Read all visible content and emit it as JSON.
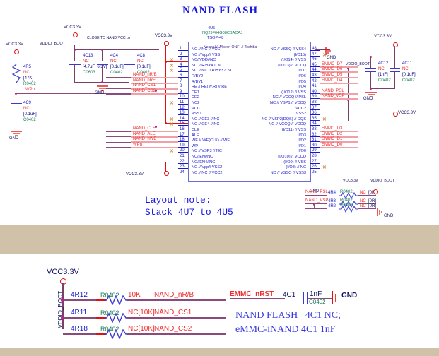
{
  "sheet": {
    "title": "NAND FLASH",
    "layout_note_line1": "Layout note:",
    "layout_note_line2": "Stack 4U7 to 4U5",
    "note_close": "CLOSE TO NAND VCC pin",
    "bottom_note_line1": "NAND FLASH   4C1 NC;",
    "bottom_note_line2": "eMMC-iNAND 4C1 1nF"
  },
  "chip": {
    "refdes": "4U5",
    "part": "NQ29F64G08CBACAJ",
    "package": "TSOP-48",
    "header": "Normal // Micron ONFI // Toshiba",
    "left_pins": [
      {
        "num": "1",
        "name": "NC // NC // VCC"
      },
      {
        "num": "2",
        "name": "NC // Vpp// VSS"
      },
      {
        "num": "3",
        "name": "NC//VDD//NC"
      },
      {
        "num": "4",
        "name": "NC // R/BY4 // NC"
      },
      {
        "num": "5",
        "name": "NC // NC // R/BY3 // NC"
      },
      {
        "num": "6",
        "name": "R/BY2"
      },
      {
        "num": "7",
        "name": "R/BY1"
      },
      {
        "num": "8",
        "name": "RE // RE(W,R) // RE"
      },
      {
        "num": "9",
        "name": "CE1"
      },
      {
        "num": "10",
        "name": "CE2"
      },
      {
        "num": "11",
        "name": "NC2"
      },
      {
        "num": "12",
        "name": "VCC1"
      },
      {
        "num": "13",
        "name": "VSS1"
      },
      {
        "num": "14",
        "name": "NC // CE3 // NC"
      },
      {
        "num": "15",
        "name": "NC // CE4 // NC"
      },
      {
        "num": "16",
        "name": "CLE"
      },
      {
        "num": "17",
        "name": "ALE"
      },
      {
        "num": "18",
        "name": "WE // WE(CLK) // WE"
      },
      {
        "num": "19",
        "name": "WP"
      },
      {
        "num": "20",
        "name": "NC // VSP3 // NC"
      },
      {
        "num": "21",
        "name": "NC//EN//NC"
      },
      {
        "num": "22",
        "name": "NC//EN4//NC"
      },
      {
        "num": "23",
        "name": "NC // Vpp// VSS2"
      },
      {
        "num": "24",
        "name": "NC // NC // VCC2"
      }
    ],
    "right_pins": [
      {
        "num": "48",
        "name": "NC // VSSQ // VSS4"
      },
      {
        "num": "47",
        "name": "(I/O15)"
      },
      {
        "num": "46",
        "name": "(I/O14) // VSS"
      },
      {
        "num": "45",
        "name": "(I/O13) // VCCQ"
      },
      {
        "num": "44",
        "name": "I/O7"
      },
      {
        "num": "43",
        "name": "I/O6"
      },
      {
        "num": "42",
        "name": "I/O5"
      },
      {
        "num": "41",
        "name": "I/O4"
      },
      {
        "num": "40",
        "name": "(I/O12) // VSS"
      },
      {
        "num": "39",
        "name": "NC // VCCQ // PSL"
      },
      {
        "num": "38",
        "name": "NC // VSP1 // VCCQ"
      },
      {
        "num": "37",
        "name": "VCC2"
      },
      {
        "num": "36",
        "name": "VSS2"
      },
      {
        "num": "35",
        "name": "NC // VSP2(DQS) // DQS"
      },
      {
        "num": "34",
        "name": "NC // VCCQ // VCCQ"
      },
      {
        "num": "33",
        "name": "(I/O11) // VSS"
      },
      {
        "num": "32",
        "name": "I/O3"
      },
      {
        "num": "31",
        "name": "I/O2"
      },
      {
        "num": "30",
        "name": "I/O1"
      },
      {
        "num": "29",
        "name": "I/O0"
      },
      {
        "num": "28",
        "name": "(I/O10) // VCCQ"
      },
      {
        "num": "27",
        "name": "(I/O9) // VSS"
      },
      {
        "num": "26",
        "name": "(I/O8) // NC"
      },
      {
        "num": "25",
        "name": "NC // VSSQ // VSS3"
      }
    ]
  },
  "power_ports": {
    "vcc1": "VCC3.3V",
    "vcc2": "VCC3.3V",
    "vcc3": "VCC3.3V",
    "vcc4": "VCC3.3V",
    "vcc5": "VCC3.3V",
    "vcc_bottom": "VCC3.3V",
    "vddio_boot1": "VDDIO_BOOT",
    "vddio_boot2": "VDDIO_BOOT",
    "vddio_boot3": "VDDIO_BOOT",
    "vddio_boot4": "VDDIO_BOOT",
    "gnd1": "GND",
    "gnd2": "GND",
    "gnd3": "GND",
    "gnd4": "GND",
    "gnd5": "GND",
    "gnd6": "GND",
    "gnd7": "GND"
  },
  "components": [
    {
      "ref": "4R5",
      "value": "NC",
      "alt": "[47K]",
      "pkg": "R0402",
      "type": "resistor"
    },
    {
      "ref": "4C9",
      "value": "NC",
      "alt": "[0.1uF]",
      "pkg": "C0402",
      "type": "cap"
    },
    {
      "ref": "4C13",
      "value": "NC",
      "alt": "[4.7uF_6.3V]",
      "pkg": "C0603",
      "type": "cap"
    },
    {
      "ref": "4C4",
      "value": "NC",
      "alt": "[0.1uF]",
      "pkg": "C0402",
      "type": "cap"
    },
    {
      "ref": "4C8",
      "value": "NC",
      "alt": "[0.1uF]",
      "pkg": "C0402",
      "type": "cap"
    },
    {
      "ref": "4C12",
      "value": "NC",
      "alt": "[1nF]",
      "pkg": "C0402",
      "type": "cap"
    },
    {
      "ref": "4C11",
      "value": "NC",
      "alt": "[0.1uF]",
      "pkg": "C0402",
      "type": "cap"
    }
  ],
  "term_resistors": [
    {
      "ref": "4R4",
      "pkg": "R0402",
      "value": "NC",
      "alt": "[0R]",
      "net": "NAND_PSL"
    },
    {
      "ref": "4R3",
      "pkg": "R0402",
      "value": "NC",
      "alt": "[0R]",
      "net": "NAND_VSP"
    },
    {
      "ref": "4R2",
      "pkg": "R0402",
      "value": "NC",
      "alt": "[0R]",
      "net": ""
    }
  ],
  "nets_left": [
    "NAND_nR/B",
    "NAND_nRE",
    "NAND_CS1",
    "NAND_CS2",
    "NAND_CLE",
    "NAND_ALE",
    "NAND_nWE",
    "WPn"
  ],
  "net_wpn": "WPn",
  "nets_right_top": [
    "EMMC_D7",
    "EMMC_D6",
    "EMMC_D5",
    "EMMC_D4"
  ],
  "nets_right_psl": [
    "NAND_PSL",
    "NAND_VSP"
  ],
  "nets_right_bot": [
    "EMMC_D3",
    "EMMC_D2",
    "EMMC_D1",
    "EMMC_D0"
  ],
  "bottom_section": {
    "rail_label": "VDDIO_BOOT",
    "vcc": "VCC3.3V",
    "rows": [
      {
        "ref": "4R12",
        "pkg": "R0402",
        "value": "10K",
        "net": "NAND_nR/B"
      },
      {
        "ref": "4R11",
        "pkg": "R0402",
        "value": "NC[10K]",
        "net": "NAND_CS1"
      },
      {
        "ref": "4R18",
        "pkg": "R0402",
        "value": "NC[10K]",
        "net": "NAND_CS2"
      }
    ],
    "cap_net": "EMMC_nRST",
    "cap_ref": "4C1",
    "cap_value": "1nF",
    "cap_pkg": "C0402",
    "cap_gnd": "GND"
  },
  "colors": {
    "wire_red": "#e01010",
    "wire_purple": "#7b3f68",
    "net_label": "#ef2d2d",
    "pin_text": "#1818c8",
    "title": "#1818e0"
  }
}
